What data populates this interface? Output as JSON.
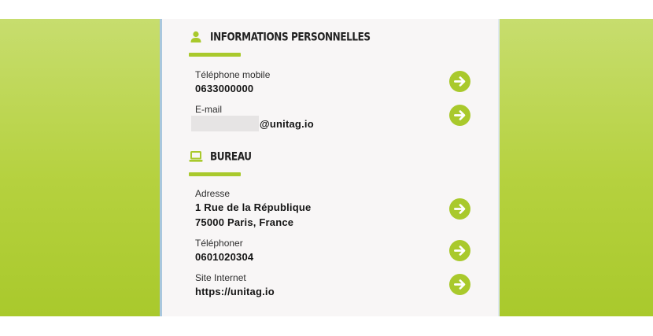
{
  "colors": {
    "accent": "#a9c92c",
    "background_band": "#b5d13e",
    "card": "#f8f6f6"
  },
  "personal": {
    "icon": "person-icon",
    "title": "INFORMATIONS PERSONNELLES",
    "mobile_label": "Téléphone mobile",
    "mobile_value": "0633000000",
    "email_label": "E-mail",
    "email_domain": "@unitag.io"
  },
  "office": {
    "icon": "laptop-icon",
    "title": "BUREAU",
    "address_label": "Adresse",
    "address_line1": "1 Rue de la République",
    "address_line2": "75000 Paris, France",
    "phone_label": "Téléphoner",
    "phone_value": "0601020304",
    "website_label": "Site Internet",
    "website_value": "https://unitag.io"
  },
  "action_icon": "arrow-right-icon"
}
